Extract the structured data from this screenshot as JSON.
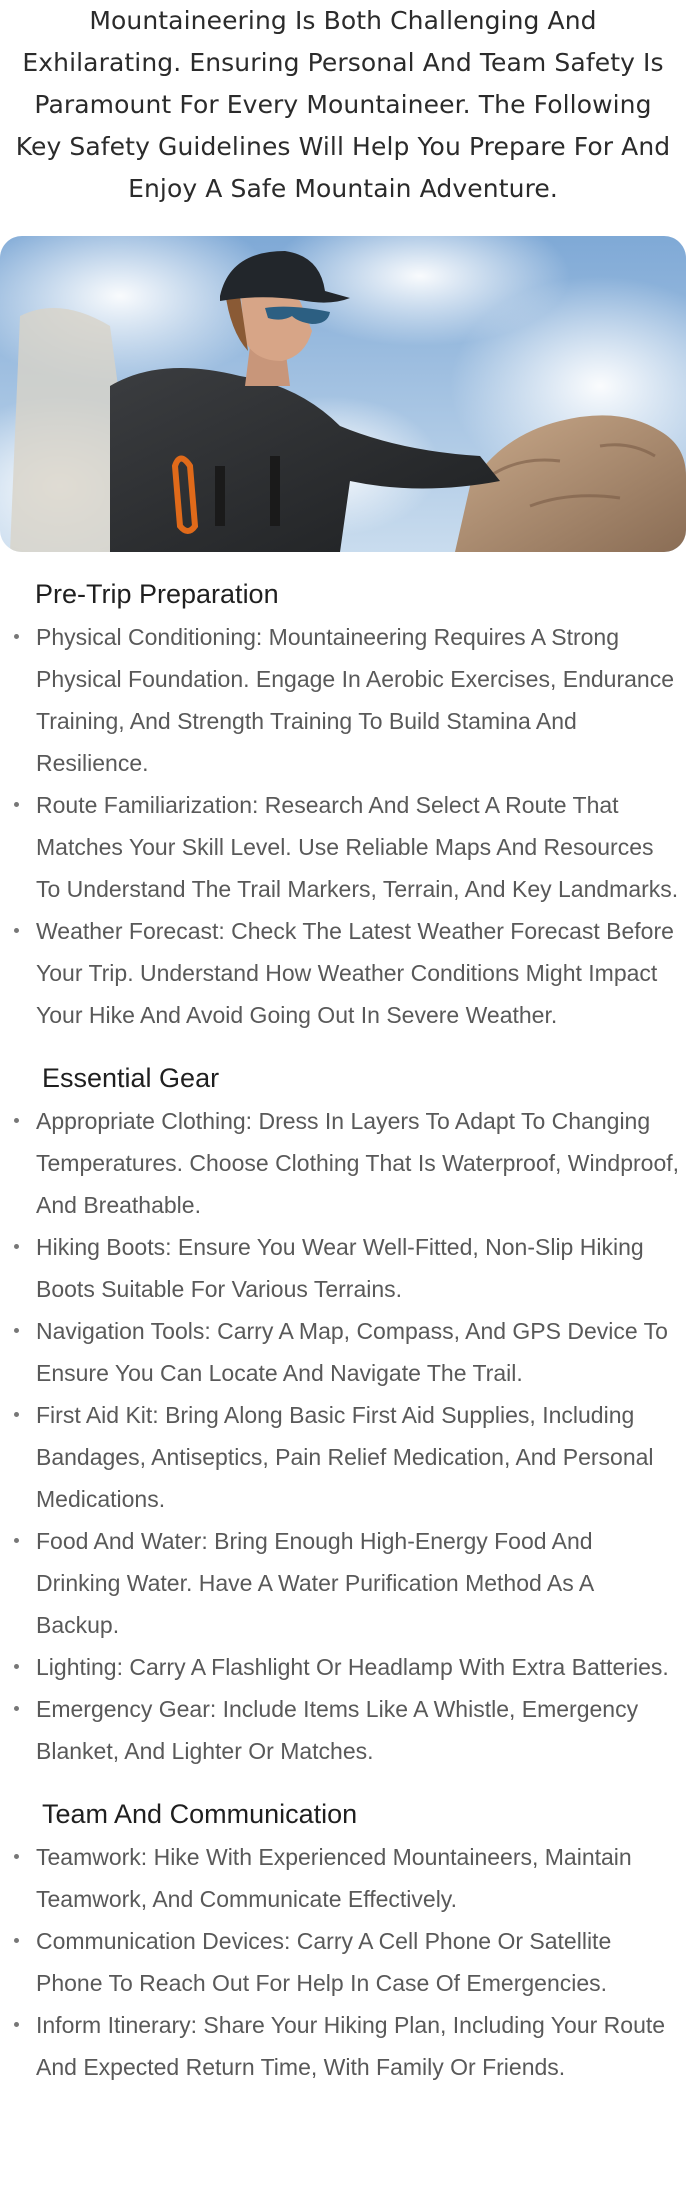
{
  "intro": {
    "text": "Mountaineering Is Both Challenging And Exhilarating. Ensuring Personal And Team Safety Is Paramount For Every Mountaineer. The Following Key Safety Guidelines Will Help You Prepare For And Enjoy A Safe Mountain Adventure."
  },
  "hero": {
    "description_icon": "mountaineer-photo"
  },
  "sections": [
    {
      "title": "Pre-Trip Preparation",
      "items": [
        "Physical Conditioning: Mountaineering Requires A Strong Physical Foundation. Engage In Aerobic Exercises, Endurance Training, And Strength Training To Build Stamina And Resilience.",
        "Route Familiarization: Research And Select A Route That Matches Your Skill Level. Use Reliable Maps And Resources To Understand The Trail Markers, Terrain, And Key Landmarks.",
        "Weather Forecast: Check The Latest Weather Forecast Before Your Trip. Understand How Weather Conditions Might Impact Your Hike And Avoid Going Out In Severe Weather."
      ]
    },
    {
      "title": "Essential Gear",
      "items": [
        "Appropriate Clothing: Dress In Layers To Adapt To Changing Temperatures. Choose Clothing That Is Waterproof, Windproof, And Breathable.",
        "Hiking Boots: Ensure You Wear Well-Fitted, Non-Slip Hiking Boots Suitable For Various Terrains.",
        "Navigation Tools: Carry A Map, Compass, And GPS Device To Ensure You Can Locate And Navigate The Trail.",
        "First Aid Kit: Bring Along Basic First Aid Supplies, Including Bandages, Antiseptics, Pain Relief Medication, And Personal Medications.",
        "Food And Water: Bring Enough High-Energy Food And Drinking Water. Have A Water Purification Method As A Backup.",
        "Lighting: Carry A Flashlight Or Headlamp With Extra Batteries.",
        "Emergency Gear: Include Items Like A Whistle, Emergency Blanket, And Lighter Or Matches."
      ]
    },
    {
      "title": "Team And Communication",
      "items": [
        "Teamwork: Hike With Experienced Mountaineers, Maintain Teamwork, And Communicate Effectively.",
        "Communication Devices: Carry A Cell Phone Or Satellite Phone To Reach Out For Help In Case Of Emergencies.",
        "Inform Itinerary: Share Your Hiking Plan, Including Your Route And Expected Return Time, With Family Or Friends."
      ]
    }
  ]
}
